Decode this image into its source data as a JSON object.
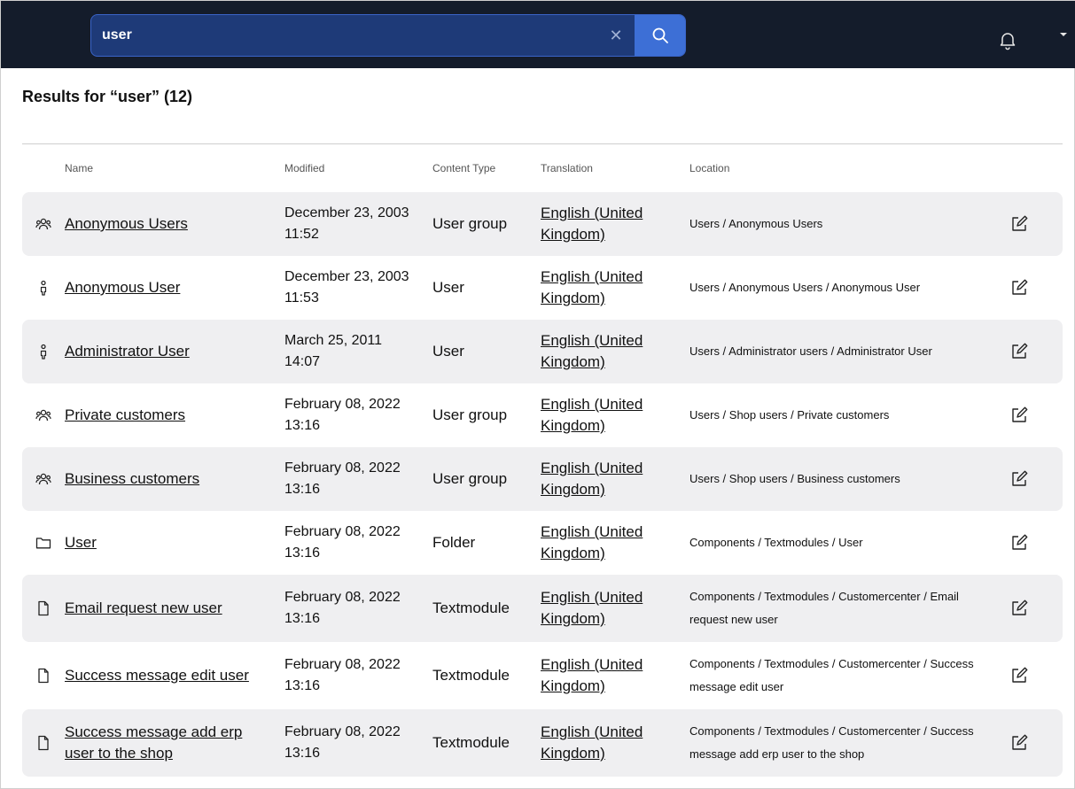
{
  "search": {
    "value": "user",
    "clear_icon": "close-icon",
    "submit_icon": "search-icon"
  },
  "header": {
    "notifications_icon": "bell-icon",
    "menu_icon": "caret-down-icon"
  },
  "results": {
    "title": "Results for “user” (12)"
  },
  "table": {
    "columns": [
      "Name",
      "Modified",
      "Content Type",
      "Translation",
      "Location"
    ],
    "rows": [
      {
        "icon": "user-group-icon",
        "name": "Anonymous Users",
        "modified": "December 23, 2003 11:52",
        "type": "User group",
        "translation": "English (United Kingdom)",
        "location": "Users / Anonymous Users"
      },
      {
        "icon": "user-icon",
        "name": "Anonymous User",
        "modified": "December 23, 2003 11:53",
        "type": "User",
        "translation": "English (United Kingdom)",
        "location": "Users / Anonymous Users / Anonymous User"
      },
      {
        "icon": "user-icon",
        "name": "Administrator User",
        "modified": "March 25, 2011 14:07",
        "type": "User",
        "translation": "English (United Kingdom)",
        "location": "Users / Administrator users / Administrator User"
      },
      {
        "icon": "user-group-icon",
        "name": "Private customers",
        "modified": "February 08, 2022 13:16",
        "type": "User group",
        "translation": "English (United Kingdom)",
        "location": "Users / Shop users / Private customers"
      },
      {
        "icon": "user-group-icon",
        "name": "Business customers",
        "modified": "February 08, 2022 13:16",
        "type": "User group",
        "translation": "English (United Kingdom)",
        "location": "Users / Shop users / Business customers"
      },
      {
        "icon": "folder-icon",
        "name": "User",
        "modified": "February 08, 2022 13:16",
        "type": "Folder",
        "translation": "English (United Kingdom)",
        "location": "Components / Textmodules / User"
      },
      {
        "icon": "document-icon",
        "name": "Email request new user",
        "modified": "February 08, 2022 13:16",
        "type": "Textmodule",
        "translation": "English (United Kingdom)",
        "location": "Components / Textmodules / Customercenter / Email request new user"
      },
      {
        "icon": "document-icon",
        "name": "Success message edit user",
        "modified": "February 08, 2022 13:16",
        "type": "Textmodule",
        "translation": "English (United Kingdom)",
        "location": "Components / Textmodules / Customercenter / Success message edit user"
      },
      {
        "icon": "document-icon",
        "name": "Success message add erp user to the shop",
        "modified": "February 08, 2022 13:16",
        "type": "Textmodule",
        "translation": "English (United Kingdom)",
        "location": "Components / Textmodules / Customercenter / Success message add erp user to the shop"
      }
    ],
    "edit_icon": "edit-icon"
  }
}
